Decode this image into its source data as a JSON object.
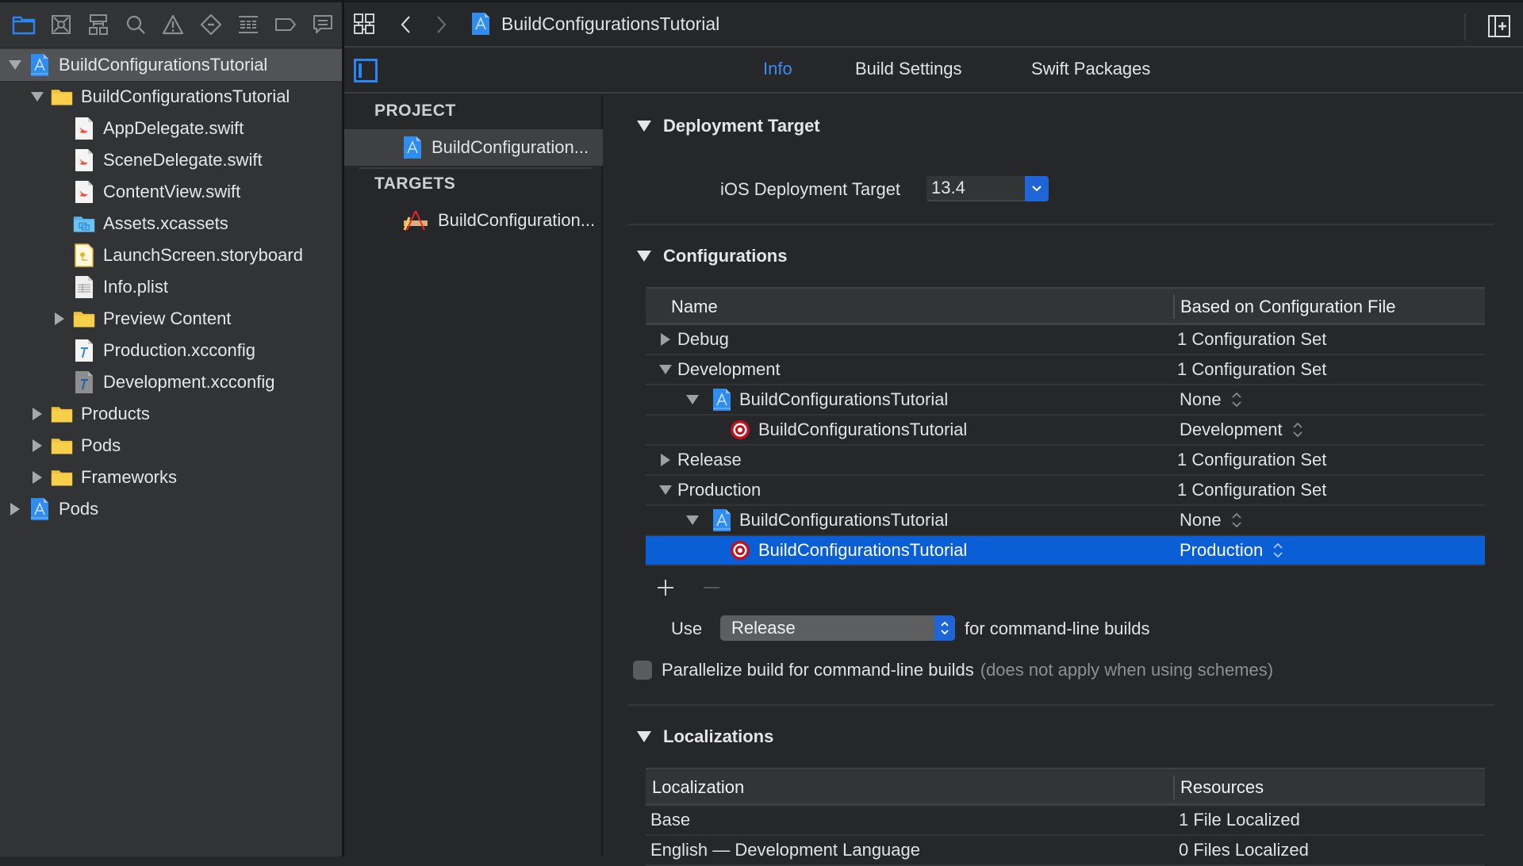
{
  "navigator": {
    "toolbar_icons": [
      "folder-icon",
      "source-control-icon",
      "hierarchy-icon",
      "search-icon",
      "warning-icon",
      "test-icon",
      "debug-icon",
      "breakpoint-icon",
      "report-icon"
    ],
    "tree": [
      {
        "label": "BuildConfigurationsTutorial",
        "icon": "xcode-project-icon",
        "level": 0,
        "disclosure": "open",
        "selected": true
      },
      {
        "label": "BuildConfigurationsTutorial",
        "icon": "folder-icon",
        "level": 1,
        "disclosure": "open"
      },
      {
        "label": "AppDelegate.swift",
        "icon": "swift-file-icon",
        "level": 2,
        "disclosure": "none"
      },
      {
        "label": "SceneDelegate.swift",
        "icon": "swift-file-icon",
        "level": 2,
        "disclosure": "none"
      },
      {
        "label": "ContentView.swift",
        "icon": "swift-file-icon",
        "level": 2,
        "disclosure": "none"
      },
      {
        "label": "Assets.xcassets",
        "icon": "asset-catalog-icon",
        "level": 2,
        "disclosure": "none"
      },
      {
        "label": "LaunchScreen.storyboard",
        "icon": "storyboard-icon",
        "level": 2,
        "disclosure": "none"
      },
      {
        "label": "Info.plist",
        "icon": "plist-icon",
        "level": 2,
        "disclosure": "none"
      },
      {
        "label": "Preview Content",
        "icon": "folder-icon",
        "level": 2,
        "disclosure": "closed"
      },
      {
        "label": "Production.xcconfig",
        "icon": "xcconfig-icon",
        "level": 2,
        "disclosure": "none"
      },
      {
        "label": "Development.xcconfig",
        "icon": "xcconfig-icon",
        "level": 2,
        "disclosure": "none"
      },
      {
        "label": "Products",
        "icon": "folder-icon",
        "level": 1,
        "disclosure": "closed"
      },
      {
        "label": "Pods",
        "icon": "folder-icon",
        "level": 1,
        "disclosure": "closed"
      },
      {
        "label": "Frameworks",
        "icon": "folder-icon",
        "level": 1,
        "disclosure": "closed"
      },
      {
        "label": "Pods",
        "icon": "xcode-project-icon",
        "level": 0,
        "disclosure": "closed"
      }
    ]
  },
  "editor": {
    "breadcrumb": "BuildConfigurationsTutorial",
    "tabs": [
      {
        "label": "Info",
        "active": true
      },
      {
        "label": "Build Settings",
        "active": false
      },
      {
        "label": "Swift Packages",
        "active": false
      }
    ],
    "project_panel": {
      "project_heading": "PROJECT",
      "project_item": "BuildConfiguration...",
      "targets_heading": "TARGETS",
      "target_item": "BuildConfiguration..."
    },
    "deployment": {
      "title": "Deployment Target",
      "label": "iOS Deployment Target",
      "value": "13.4"
    },
    "configurations": {
      "title": "Configurations",
      "columns": [
        "Name",
        "Based on Configuration File"
      ],
      "rows": [
        {
          "name": "Debug",
          "level": 0,
          "disclosure": "closed",
          "icon": "",
          "value": "1 Configuration Set",
          "popup": false
        },
        {
          "name": "Development",
          "level": 0,
          "disclosure": "open",
          "icon": "",
          "value": "1 Configuration Set",
          "popup": false
        },
        {
          "name": "BuildConfigurationsTutorial",
          "level": 1,
          "disclosure": "open",
          "icon": "xcode-project-icon",
          "value": "None",
          "popup": true
        },
        {
          "name": "BuildConfigurationsTutorial",
          "level": 2,
          "disclosure": "none",
          "icon": "target-icon",
          "value": "Development",
          "popup": true
        },
        {
          "name": "Release",
          "level": 0,
          "disclosure": "closed",
          "icon": "",
          "value": "1 Configuration Set",
          "popup": false
        },
        {
          "name": "Production",
          "level": 0,
          "disclosure": "open",
          "icon": "",
          "value": "1 Configuration Set",
          "popup": false
        },
        {
          "name": "BuildConfigurationsTutorial",
          "level": 1,
          "disclosure": "open",
          "icon": "xcode-project-icon",
          "value": "None",
          "popup": true
        },
        {
          "name": "BuildConfigurationsTutorial",
          "level": 2,
          "disclosure": "none",
          "icon": "target-icon",
          "value": "Production",
          "popup": true,
          "selected": true
        }
      ],
      "use_label": "Use",
      "use_value": "Release",
      "use_suffix": "for command-line builds",
      "parallelize_label": "Parallelize build for command-line builds",
      "parallelize_note": "(does not apply when using schemes)",
      "parallelize_checked": false
    },
    "localizations": {
      "title": "Localizations",
      "columns": [
        "Localization",
        "Resources"
      ],
      "rows": [
        {
          "name": "Base",
          "value": "1 File Localized"
        },
        {
          "name": "English — Development Language",
          "value": "0 Files Localized"
        }
      ]
    }
  },
  "colors": {
    "accent": "#1f65d8",
    "selection": "#0a5fd6",
    "tab_active": "#3d8bf2",
    "folder": "#f5c542"
  }
}
